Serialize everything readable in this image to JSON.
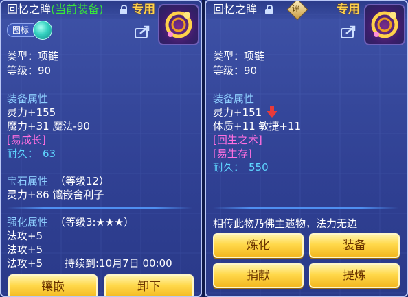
{
  "left": {
    "title": "回忆之眸",
    "current_tag": "(当前装备)",
    "special_label": "专用",
    "toggle_label": "图标",
    "type": "类型：项链",
    "level": "等级：90",
    "attr_header": "装备属性",
    "attr_lines": [
      "灵力+155",
      "魔力+31 魔法-90"
    ],
    "special_effect": "[易成长]",
    "durability_label": "耐久：",
    "durability_value": "63",
    "gem_header": "宝石属性",
    "gem_level": "（等级12）",
    "gem_line": "灵力+86 镶嵌舍利子",
    "strengthen_header": "强化属性",
    "strengthen_level": "（等级3:★★★）",
    "strengthen_lines": [
      "法攻+5",
      "法攻+5",
      "法攻+5"
    ],
    "duration": "持续到:10月7日 00:00",
    "buttons": [
      "镶嵌",
      "卸下"
    ]
  },
  "right": {
    "title": "回忆之眸",
    "special_label": "专用",
    "badge": "评",
    "type": "类型：项链",
    "level": "等级：90",
    "attr_header": "装备属性",
    "attr_lines": [
      "灵力+151",
      "体质+11 敏捷+11"
    ],
    "special_effects": [
      "[回生之术]",
      "[易生存]"
    ],
    "durability_label": "耐久：",
    "durability_value": "550",
    "description": "相传此物乃佛主遗物，法力无边",
    "buttons": [
      "炼化",
      "装备",
      "捐献",
      "提炼"
    ]
  },
  "colors": {
    "gold_button": "#ffd84a",
    "header_blue": "#8fd0ff",
    "effect_pink": "#ff6fe0",
    "equipped_green": "#39e639",
    "decrease_arrow": "#e83a3a"
  }
}
